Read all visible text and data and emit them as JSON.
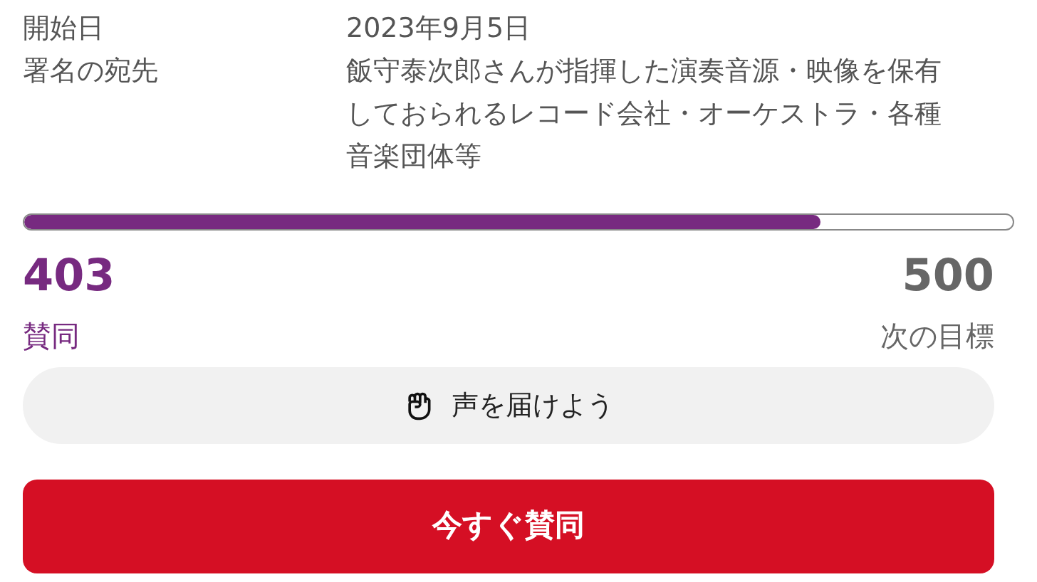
{
  "details": [
    {
      "label": "開始日",
      "value": "2023年9月5日"
    },
    {
      "label": "署名の宛先",
      "value": "飯守泰次郎さんが指揮した演奏音源・映像を保有しておられるレコード会社・オーケストラ・各種音楽団体等"
    }
  ],
  "progress": {
    "level": 0.806,
    "count": "403",
    "count_label": "賛同",
    "goal": "500",
    "goal_label": "次の目標"
  },
  "share_button": {
    "label": "声を届けよう"
  },
  "sign_button": {
    "label": "今すぐ賛同"
  }
}
